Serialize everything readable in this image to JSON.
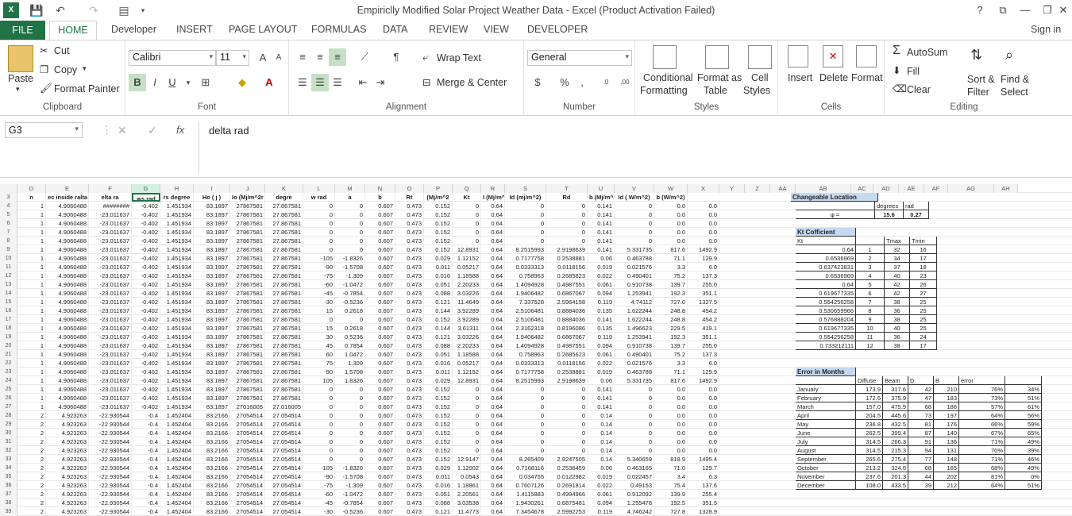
{
  "title": "Empiriclly Modified Solar Project Weather Data - Excel (Product Activation Failed)",
  "window_controls": [
    "?",
    "⧉",
    "—",
    "❐",
    "✕"
  ],
  "menu": {
    "file": "FILE",
    "tabs": [
      "HOME",
      "Developer",
      "INSERT",
      "PAGE LAYOUT",
      "FORMULAS",
      "DATA",
      "REVIEW",
      "VIEW",
      "DEVELOPER"
    ],
    "sign_in": "Sign in"
  },
  "ribbon": {
    "clipboard": {
      "paste": "Paste",
      "cut": "Cut",
      "copy": "Copy",
      "format_painter": "Format Painter",
      "label": "Clipboard"
    },
    "font": {
      "name": "Calibri",
      "size": "11",
      "label": "Font",
      "bold": "B",
      "italic": "I",
      "underline": "U"
    },
    "alignment": {
      "wrap": "Wrap Text",
      "merge": "Merge & Center",
      "label": "Alignment"
    },
    "number": {
      "format": "General",
      "currency": "$",
      "percent": "%",
      "comma": ",",
      "label": "Number"
    },
    "styles": {
      "conditional": "Conditional",
      "conditional2": "Formatting",
      "format_as": "Format as",
      "format_as2": "Table",
      "cell": "Cell",
      "cell2": "Styles",
      "label": "Styles"
    },
    "cells": {
      "insert": "Insert",
      "delete": "Delete",
      "format": "Format",
      "label": "Cells"
    },
    "editing": {
      "autosum": "AutoSum",
      "fill": "Fill",
      "clear": "Clear",
      "sort": "Sort &",
      "sort2": "Filter",
      "find": "Find &",
      "find2": "Select",
      "label": "Editing"
    }
  },
  "formula_bar": {
    "name_box": "G3",
    "formula": "delta rad"
  },
  "columns": [
    "D",
    "E",
    "F",
    "G",
    "H",
    "I",
    "J",
    "K",
    "L",
    "M",
    "N",
    "O",
    "P",
    "Q",
    "R",
    "S",
    "T",
    "U",
    "V",
    "W",
    "X",
    "Y",
    "Z",
    "AA",
    "AB",
    "AC",
    "AD",
    "AE",
    "AF",
    "AG",
    "AH"
  ],
  "header_row": [
    "n",
    "ec inside ralta ( degree",
    "elta ra",
    "ws rad",
    "rs degree",
    "Ho ( j )",
    "Io (Mj/m^2r",
    "degre",
    "w rad",
    "a",
    "b",
    "Rt",
    "(Mj/m^2",
    "Kt",
    "I (Mj/m^2)",
    "Id (mj/m^2)",
    "Rd",
    "b (Mj/m^2",
    "Id ( W/m^2)",
    "b (W/m^2)"
  ],
  "rows": [
    [
      "4",
      "1",
      "4.9060488",
      "########",
      "-0.402",
      "1.451934",
      "83.1897",
      "27867581",
      "27.867581",
      "0",
      "0",
      "0.607",
      "0.473",
      "0.152",
      "0",
      "0.64",
      "0",
      "0",
      "0.141",
      "0",
      "0.0",
      "0.0"
    ],
    [
      "5",
      "1",
      "4.9060488",
      "-23.011637",
      "-0.402",
      "1.451934",
      "83.1897",
      "27867581",
      "27.867581",
      "0",
      "0",
      "0.607",
      "0.473",
      "0.152",
      "0",
      "0.64",
      "0",
      "0",
      "0.141",
      "0",
      "0.0",
      "0.0"
    ],
    [
      "6",
      "1",
      "4.9060488",
      "-23.011637",
      "-0.402",
      "1.451934",
      "83.1897",
      "27867581",
      "27.867581",
      "0",
      "0",
      "0.607",
      "0.473",
      "0.152",
      "0",
      "0.64",
      "0",
      "0",
      "0.141",
      "0",
      "0.0",
      "0.0"
    ],
    [
      "7",
      "1",
      "4.9060488",
      "-23.011637",
      "-0.402",
      "1.451934",
      "83.1897",
      "27867581",
      "27.867581",
      "0",
      "0",
      "0.607",
      "0.473",
      "0.152",
      "0",
      "0.64",
      "0",
      "0",
      "0.141",
      "0",
      "0.0",
      "0.0"
    ],
    [
      "8",
      "1",
      "4.9060488",
      "-23.011637",
      "-0.402",
      "1.451934",
      "83.1897",
      "27867581",
      "27.867581",
      "0",
      "0",
      "0.607",
      "0.473",
      "0.152",
      "0",
      "0.64",
      "0",
      "0",
      "0.141",
      "0",
      "0.0",
      "0.0"
    ],
    [
      "9",
      "1",
      "4.9060488",
      "-23.011637",
      "-0.402",
      "1.451934",
      "83.1897",
      "27867581",
      "27.867581",
      "0",
      "0",
      "0.607",
      "0.473",
      "0.152",
      "12.8931",
      "0.64",
      "8.2515993",
      "2.9198639",
      "0.141",
      "5.331735",
      "817.6",
      "1492.9"
    ],
    [
      "10",
      "1",
      "4.9060488",
      "-23.011637",
      "-0.402",
      "1.451934",
      "83.1897",
      "27867581",
      "27.867581",
      "-105",
      "-1.8326",
      "0.607",
      "0.473",
      "0.029",
      "1.12152",
      "0.64",
      "0.7177758",
      "0.2538881",
      "0.06",
      "0.463788",
      "71.1",
      "129.9"
    ],
    [
      "11",
      "1",
      "4.9060488",
      "-23.011637",
      "-0.402",
      "1.451934",
      "83.1897",
      "27867581",
      "27.867581",
      "-90",
      "-1.5708",
      "0.607",
      "0.473",
      "0.011",
      "0.05217",
      "0.64",
      "0.0333313",
      "0.0118156",
      "0.019",
      "0.021576",
      "3.3",
      "6.0"
    ],
    [
      "12",
      "1",
      "4.9060488",
      "-23.011637",
      "-0.402",
      "1.451934",
      "83.1897",
      "27867581",
      "27.867581",
      "-75",
      "-1.309",
      "0.607",
      "0.473",
      "0.016",
      "1.18588",
      "0.64",
      "0.758963",
      "0.2685623",
      "0.022",
      "0.490401",
      "75.2",
      "137.3"
    ],
    [
      "13",
      "1",
      "4.9060488",
      "-23.011637",
      "-0.402",
      "1.451934",
      "83.1897",
      "27867581",
      "27.867581",
      "-60",
      "-1.0472",
      "0.607",
      "0.473",
      "0.051",
      "2.20233",
      "0.64",
      "1.4094928",
      "0.4987551",
      "0.061",
      "0.910738",
      "139.7",
      "255.0"
    ],
    [
      "14",
      "1",
      "4.9060488",
      "-23.011637",
      "-0.402",
      "1.451934",
      "83.1897",
      "27867581",
      "27.867581",
      "-45",
      "-0.7854",
      "0.607",
      "0.473",
      "0.088",
      "3.03226",
      "0.64",
      "1.9406482",
      "0.6867067",
      "0.094",
      "1.253941",
      "192.3",
      "351.1"
    ],
    [
      "15",
      "1",
      "4.9060488",
      "-23.011637",
      "-0.402",
      "1.451934",
      "83.1897",
      "27867581",
      "27.867581",
      "-30",
      "-0.5236",
      "0.607",
      "0.473",
      "0.121",
      "11.4649",
      "0.64",
      "7.337528",
      "2.5964158",
      "0.119",
      "4.74112",
      "727.0",
      "1327.5"
    ],
    [
      "16",
      "1",
      "4.9060488",
      "-23.011637",
      "-0.402",
      "1.451934",
      "83.1897",
      "27867581",
      "27.867581",
      "15",
      "0.2618",
      "0.607",
      "0.473",
      "0.144",
      "3.92289",
      "0.64",
      "2.5106481",
      "0.8884036",
      "0.135",
      "1.622244",
      "248.8",
      "454.2"
    ],
    [
      "17",
      "1",
      "4.9060488",
      "-23.011637",
      "-0.402",
      "1.451934",
      "83.1897",
      "27867581",
      "27.867581",
      "0",
      "0",
      "0.607",
      "0.473",
      "0.152",
      "3.92289",
      "0.64",
      "2.5106481",
      "0.8884036",
      "0.141",
      "1.622244",
      "248.8",
      "454.2"
    ],
    [
      "18",
      "1",
      "4.9060488",
      "-23.011637",
      "-0.402",
      "1.451934",
      "83.1897",
      "27867581",
      "27.867581",
      "15",
      "0.2618",
      "0.607",
      "0.473",
      "0.144",
      "3.61311",
      "0.64",
      "2.3162318",
      "0.8196086",
      "0.135",
      "1.496623",
      "229.5",
      "419.1"
    ],
    [
      "19",
      "1",
      "4.9060488",
      "-23.011637",
      "-0.402",
      "1.451934",
      "83.1897",
      "27867581",
      "27.867581",
      "30",
      "0.5236",
      "0.607",
      "0.473",
      "0.121",
      "3.03226",
      "0.64",
      "1.9406482",
      "0.6867067",
      "0.119",
      "1.253941",
      "192.3",
      "351.1"
    ],
    [
      "20",
      "1",
      "4.9060488",
      "-23.011637",
      "-0.402",
      "1.451934",
      "83.1897",
      "27867581",
      "27.867581",
      "45",
      "0.7854",
      "0.607",
      "0.473",
      "0.088",
      "2.20233",
      "0.64",
      "1.4094928",
      "0.4987551",
      "0.094",
      "0.910738",
      "139.7",
      "255.0"
    ],
    [
      "21",
      "1",
      "4.9060488",
      "-23.011637",
      "-0.402",
      "1.451934",
      "83.1897",
      "27867581",
      "27.867581",
      "60",
      "1.0472",
      "0.607",
      "0.473",
      "0.051",
      "1.18588",
      "0.64",
      "0.758963",
      "0.2685623",
      "0.061",
      "0.490401",
      "75.2",
      "137.3"
    ],
    [
      "22",
      "1",
      "4.9060488",
      "-23.011637",
      "-0.402",
      "1.451934",
      "83.1897",
      "27867581",
      "27.867581",
      "75",
      "1.309",
      "0.607",
      "0.473",
      "0.016",
      "0.05217",
      "0.64",
      "0.0333313",
      "0.0118156",
      "0.022",
      "0.021576",
      "3.3",
      "6.0"
    ],
    [
      "23",
      "1",
      "4.9060488",
      "-23.011637",
      "-0.402",
      "1.451934",
      "83.1897",
      "27867581",
      "27.867581",
      "90",
      "1.5708",
      "0.607",
      "0.473",
      "0.011",
      "1.12152",
      "0.64",
      "0.7177758",
      "0.2538881",
      "0.019",
      "0.463788",
      "71.1",
      "129.9"
    ],
    [
      "24",
      "1",
      "4.9060488",
      "-23.011637",
      "-0.402",
      "1.451934",
      "83.1897",
      "27867581",
      "27.867581",
      "105",
      "1.8326",
      "0.607",
      "0.473",
      "0.029",
      "12.8931",
      "0.64",
      "8.2515993",
      "2.9198639",
      "0.06",
      "5.331735",
      "817.6",
      "1492.9"
    ],
    [
      "25",
      "1",
      "4.9060488",
      "-23.011637",
      "-0.402",
      "1.451934",
      "83.1897",
      "27867581",
      "27.867581",
      "0",
      "0",
      "0.607",
      "0.473",
      "0.152",
      "0",
      "0.64",
      "0",
      "0",
      "0.141",
      "0",
      "0.0",
      "0.0"
    ],
    [
      "26",
      "1",
      "4.9060488",
      "-23.011637",
      "-0.402",
      "1.451934",
      "83.1897",
      "27867581",
      "27.867581",
      "0",
      "0",
      "0.607",
      "0.473",
      "0.152",
      "0",
      "0.64",
      "0",
      "0",
      "0.141",
      "0",
      "0.0",
      "0.0"
    ],
    [
      "27",
      "1",
      "4.9060488",
      "-23.011637",
      "-0.402",
      "1.451934",
      "83.1897",
      "27016005",
      "27.016005",
      "0",
      "0",
      "0.607",
      "0.473",
      "0.152",
      "0",
      "0.64",
      "0",
      "0",
      "0.141",
      "0",
      "0.0",
      "0.0"
    ],
    [
      "28",
      "2",
      "4.923263",
      "-22.930544",
      "-0.4",
      "1.452404",
      "83.2166",
      "27054514",
      "27.054514",
      "0",
      "0",
      "0.607",
      "0.473",
      "0.152",
      "0",
      "0.64",
      "0",
      "0",
      "0.14",
      "0",
      "0.0",
      "0.0"
    ],
    [
      "29",
      "2",
      "4.923263",
      "-22.930544",
      "-0.4",
      "1.452404",
      "83.2166",
      "27054514",
      "27.054514",
      "0",
      "0",
      "0.607",
      "0.473",
      "0.152",
      "0",
      "0.64",
      "0",
      "0",
      "0.14",
      "0",
      "0.0",
      "0.0"
    ],
    [
      "30",
      "2",
      "4.923263",
      "-22.930544",
      "-0.4",
      "1.452404",
      "83.2166",
      "27054514",
      "27.054514",
      "0",
      "0",
      "0.607",
      "0.473",
      "0.152",
      "0",
      "0.64",
      "0",
      "0",
      "0.14",
      "0",
      "0.0",
      "0.0"
    ],
    [
      "31",
      "2",
      "4.923263",
      "-22.930544",
      "-0.4",
      "1.452404",
      "83.2166",
      "27054514",
      "27.054514",
      "0",
      "0",
      "0.607",
      "0.473",
      "0.152",
      "0",
      "0.64",
      "0",
      "0",
      "0.14",
      "0",
      "0.0",
      "0.0"
    ],
    [
      "32",
      "2",
      "4.923263",
      "-22.930544",
      "-0.4",
      "1.452404",
      "83.2166",
      "27054514",
      "27.054514",
      "0",
      "0",
      "0.607",
      "0.473",
      "0.152",
      "0",
      "0.64",
      "0",
      "0",
      "0.14",
      "0",
      "0.0",
      "0.0"
    ],
    [
      "33",
      "2",
      "4.923263",
      "-22.930544",
      "-0.4",
      "1.452404",
      "83.2166",
      "27054514",
      "27.054514",
      "0",
      "0",
      "0.607",
      "0.473",
      "0.152",
      "12.9147",
      "0.64",
      "8.265409",
      "2.9247505",
      "0.14",
      "5.340659",
      "818.9",
      "1495.4"
    ],
    [
      "34",
      "2",
      "4.923263",
      "-22.930544",
      "-0.4",
      "1.452404",
      "83.2166",
      "27054514",
      "27.054514",
      "-105",
      "-1.8326",
      "0.607",
      "0.473",
      "0.029",
      "1.12002",
      "0.64",
      "0.7168116",
      "0.2536459",
      "0.06",
      "0.463165",
      "71.0",
      "129.7"
    ],
    [
      "35",
      "2",
      "4.923263",
      "-22.930544",
      "-0.4",
      "1.452404",
      "83.2166",
      "27054514",
      "27.054514",
      "-90",
      "-1.5708",
      "0.607",
      "0.473",
      "0.011",
      "0.0543",
      "0.64",
      "0.034755",
      "0.0122982",
      "0.019",
      "0.022457",
      "3.4",
      "6.3"
    ],
    [
      "36",
      "2",
      "4.923263",
      "-22.930544",
      "-0.4",
      "1.452404",
      "83.2166",
      "27054514",
      "27.054514",
      "-75",
      "-1.309",
      "0.607",
      "0.473",
      "0.016",
      "1.18861",
      "0.64",
      "0.7607126",
      "0.2691814",
      "0.022",
      "0.49153",
      "75.4",
      "137.6"
    ],
    [
      "37",
      "2",
      "4.923263",
      "-22.930544",
      "-0.4",
      "1.452404",
      "83.2166",
      "27054514",
      "27.054514",
      "-60",
      "-1.0472",
      "0.607",
      "0.473",
      "0.051",
      "2.20561",
      "0.64",
      "1.4115883",
      "0.4994966",
      "0.061",
      "0.912092",
      "139.9",
      "255.4"
    ],
    [
      "38",
      "2",
      "4.923263",
      "-22.930544",
      "-0.4",
      "1.452404",
      "83.2166",
      "27054514",
      "27.054514",
      "-45",
      "-0.7854",
      "0.607",
      "0.473",
      "0.088",
      "3.03538",
      "0.64",
      "1.9430261",
      "0.6875481",
      "0.094",
      "1.255478",
      "192.5",
      "351.5"
    ],
    [
      "39",
      "2",
      "4.923263",
      "-22.930544",
      "-0.4",
      "1.452404",
      "83.2166",
      "27054514",
      "27.054514",
      "-30",
      "-0.5236",
      "0.607",
      "0.473",
      "0.121",
      "11.4773",
      "0.64",
      "7.3454678",
      "2.5992253",
      "0.119",
      "4.746242",
      "727.8",
      "1328.9"
    ]
  ],
  "location": {
    "title": "Changeable Location",
    "h_degrees": "degrees",
    "h_rad": "rad",
    "phi": "φ =",
    "degrees": "15.6",
    "rad": "0.27"
  },
  "kt": {
    "title": "Kt Cofficient",
    "headers": [
      "Kt",
      "",
      "Tmax",
      "Tmin"
    ],
    "rows": [
      [
        "0.64",
        "1",
        "32",
        "16"
      ],
      [
        "0.6536969",
        "2",
        "34",
        "17"
      ],
      [
        "0.637423831",
        "3",
        "37",
        "18"
      ],
      [
        "0.6536969",
        "4",
        "40",
        "23"
      ],
      [
        "0.64",
        "5",
        "42",
        "26"
      ],
      [
        "0.619677335",
        "6",
        "42",
        "27"
      ],
      [
        "0.554256258",
        "7",
        "38",
        "25"
      ],
      [
        "0.530659966",
        "8",
        "36",
        "25"
      ],
      [
        "0.576888204",
        "9",
        "38",
        "25"
      ],
      [
        "0.619677335",
        "10",
        "40",
        "25"
      ],
      [
        "0.554256258",
        "11",
        "36",
        "24"
      ],
      [
        "0.733212111",
        "12",
        "38",
        "17"
      ]
    ]
  },
  "error": {
    "title": "Error in Months",
    "headers": [
      "",
      "Diffuse",
      "Beam",
      "D",
      "B",
      "error",
      ""
    ],
    "rows": [
      [
        "January",
        "173.9",
        "317.6",
        "42",
        "210",
        "76%",
        "34%"
      ],
      [
        "February",
        "172.6",
        "375.9",
        "47",
        "183",
        "73%",
        "51%"
      ],
      [
        "March",
        "157.0",
        "475.9",
        "68",
        "186",
        "57%",
        "61%"
      ],
      [
        "April",
        "204.5",
        "445.6",
        "73",
        "197",
        "64%",
        "56%"
      ],
      [
        "May",
        "236.8",
        "432.5",
        "81",
        "176",
        "66%",
        "59%"
      ],
      [
        "June",
        "262.5",
        "399.4",
        "87",
        "140",
        "67%",
        "65%"
      ],
      [
        "July",
        "314.5",
        "266.3",
        "91",
        "136",
        "71%",
        "49%"
      ],
      [
        "August",
        "314.5",
        "215.3",
        "94",
        "131",
        "70%",
        "39%"
      ],
      [
        "September",
        "265.6",
        "275.4",
        "77",
        "148",
        "71%",
        "46%"
      ],
      [
        "October",
        "213.2",
        "324.6",
        "68",
        "165",
        "68%",
        "49%"
      ],
      [
        "November",
        "237.6",
        "201.3",
        "44",
        "202",
        "81%",
        "0%"
      ],
      [
        "December",
        "108.0",
        "433.5",
        "39",
        "212",
        "64%",
        "51%"
      ]
    ]
  },
  "colors": {
    "excel_green": "#217346",
    "selected_header": "#d3f0e0",
    "panel_title": "#c5d9f1"
  }
}
